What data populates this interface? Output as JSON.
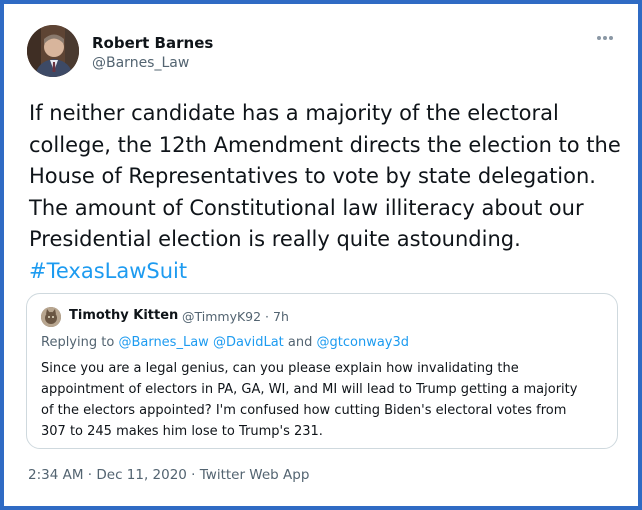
{
  "tweet": {
    "author_name": "Robert Barnes",
    "author_handle": "@Barnes_Law",
    "text_lines": [
      "If neither candidate has a majority of the electoral",
      "college, the 12th Amendment directs the election to the",
      "House of Representatives to vote by state delegation.",
      "The amount of Constitutional law illiteracy about our",
      "Presidential election is really quite astounding."
    ],
    "hashtag": "#TexasLawSuit",
    "timestamp": "2:34 AM · Dec 11, 2020 · Twitter Web App"
  },
  "quote": {
    "author_name": "Timothy Kitten",
    "meta": "@TimmyK92 · 7h",
    "replying_prefix": "Replying to ",
    "reply_handle_1": "@Barnes_Law",
    "reply_handle_2": "@DavidLat",
    "reply_and": " and ",
    "reply_handle_3": "@gtconway3d",
    "text_lines": [
      "Since you are a legal genius, can you please explain how invalidating the",
      "appointment of electors in PA, GA, WI, and MI will lead to Trump getting a majority",
      "of the electors appointed? I'm confused how cutting Biden's electoral votes from",
      "307 to 245 makes him lose to Trump's 231."
    ]
  },
  "icons": {
    "more": "more-options-icon"
  },
  "colors": {
    "frame_border": "#2f6bc4",
    "link": "#1d9bf0",
    "secondary_text": "#536471"
  }
}
